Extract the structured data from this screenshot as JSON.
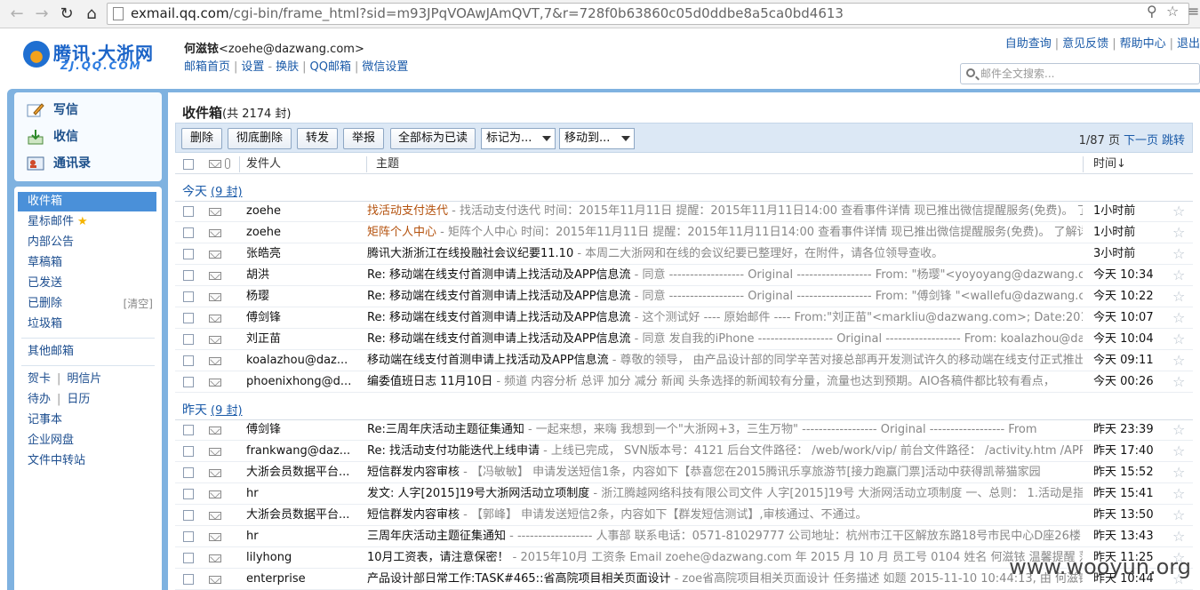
{
  "browser": {
    "url_host": "exmail.qq.com",
    "url_path": "/cgi-bin/frame_html?sid=m93JPqVOAwJAmQVT,7&r=728f0b63860c05d0ddbe8a5ca0bd4613"
  },
  "brand": {
    "name": "腾讯·大浙网",
    "sub": "ZJ.QQ.COM"
  },
  "user": {
    "name": "何滋铱",
    "email": "<zoehe@dazwang.com>"
  },
  "user_links": [
    "邮箱首页",
    "设置",
    "换肤",
    "QQ邮箱",
    "微信设置"
  ],
  "top_links": [
    "自助查询",
    "意见反馈",
    "帮助中心",
    "退出"
  ],
  "search": {
    "placeholder": "邮件全文搜索..."
  },
  "quick": {
    "compose": "写信",
    "receive": "收信",
    "contacts": "通讯录"
  },
  "nav": {
    "inbox": "收件箱",
    "starred": "星标邮件",
    "notice": "内部公告",
    "drafts": "草稿箱",
    "sent": "已发送",
    "deleted": "已删除",
    "deleted_extra": "[清空]",
    "spam": "垃圾箱",
    "other": "其他邮箱",
    "greeting": "贺卡",
    "postcard": "明信片",
    "todo": "待办",
    "calendar": "日历",
    "notes": "记事本",
    "disk": "企业网盘",
    "transfer": "文件中转站"
  },
  "mailbox": {
    "title": "收件箱",
    "count": "(共 2174 封)"
  },
  "toolbar": {
    "delete": "删除",
    "purge": "彻底删除",
    "forward": "转发",
    "report": "举报",
    "mark_all_read": "全部标为已读",
    "mark_as": "标记为...",
    "move_to": "移动到..."
  },
  "pager": {
    "page": "1/87 页",
    "next": "下一页",
    "jump": "跳转"
  },
  "columns": {
    "sender": "发件人",
    "subject": "主题",
    "time": "时间↓"
  },
  "groups": {
    "today": "今天",
    "today_count": "(9 封)",
    "yesterday": "昨天",
    "yesterday_count": "(9 封)"
  },
  "today_rows": [
    {
      "sender": "zoehe",
      "subject": "找活动支付迭代",
      "preview": " - 找活动支付迭代 时间：2015年11月11日 提醒：2015年11月11日14:00 查看事件详情 现已推出微信提醒服务(免费)。 了解详情",
      "time": "1小时前"
    },
    {
      "sender": "zoehe",
      "subject": "矩阵个人中心",
      "preview": " - 矩阵个人中心 时间：2015年11月11日 提醒：2015年11月11日14:00 查看事件详情 现已推出微信提醒服务(免费)。 了解详情 您的",
      "time": "1小时前"
    },
    {
      "sender": "张皓亮",
      "subject": "腾讯大浙浙江在线投融社会议纪要11.10",
      "preview": " - 本周二大浙网和在线的会议纪要已整理好，在附件，请各位领导查收。",
      "time": "3小时前"
    },
    {
      "sender": "胡洪",
      "subject": "Re: 移动端在线支付首测申请上找活动及APP信息流",
      "preview": " - 同意 ------------------ Original ------------------ From: \"杨璎\"<yoyoyang@dazwang.com>",
      "time": "今天 10:34"
    },
    {
      "sender": "杨璎",
      "subject": "Re: 移动端在线支付首测申请上找活动及APP信息流",
      "preview": " - 同意 ------------------ Original ------------------ From: \"傅剑锋 \"<wallefu@dazwang.com>",
      "time": "今天 10:22"
    },
    {
      "sender": "傅剑锋",
      "subject": "Re: 移动端在线支付首测申请上找活动及APP信息流",
      "preview": " - 这个测试好 ---- 原始邮件 ---- From:\"刘正苗\"<markliu@dazwang.com>; Date:2015年11月",
      "time": "今天 10:07"
    },
    {
      "sender": "刘正苗",
      "subject": "Re: 移动端在线支付首测申请上找活动及APP信息流",
      "preview": " - 同意 发自我的iPhone ------------------ Original ------------------ From: koalazhou@dazwang",
      "time": "今天 10:04"
    },
    {
      "sender": "koalazhou@daz...",
      "subject": "移动端在线支付首测申请上找活动及APP信息流",
      "preview": " - 尊敬的领导， 由产品设计部的同学辛苦对接总部再开发测试许久的移动端在线支付正式推出，总部支付",
      "time": "今天 09:11"
    },
    {
      "sender": "phoenixhong@d...",
      "subject": "编委值班日志 11月10日",
      "preview": " - 频道 内容分析 总评 加分 减分 新闻 头条选择的新闻较有分量，流量也达到预期。AIO各稿件都比较有看点，",
      "time": "今天 00:26"
    }
  ],
  "yesterday_rows": [
    {
      "sender": "傅剑锋",
      "subject": "Re:三周年庆活动主题征集通知",
      "preview": " - 一起来想，来嗨 我想到一个\"大浙网+3，三生万物\" ------------------ Original ------------------ From",
      "time": "昨天 23:39"
    },
    {
      "sender": "frankwang@daz...",
      "subject": "Re: 找活动支付功能迭代上线申请",
      "preview": " - 上线已完成， SVN版本号：4121 后台文件路径： /web/work/vip/ 前台文件路径： /activity.htm /APP/android",
      "time": "昨天 17:40"
    },
    {
      "sender": "大浙会员数据平台...",
      "subject": "短信群发内容审核",
      "preview": " - 【冯敏敏】 申请发送短信1条，内容如下【恭喜您在2015腾讯乐享旅游节[接力跑赢门票]活动中获得凯蒂猫家园",
      "time": "昨天 15:52"
    },
    {
      "sender": "hr",
      "subject": "发文: 人字[2015]19号大浙网活动立项制度",
      "preview": " - 浙江腾越网络科技有限公司文件 人字[2015]19号 大浙网活动立项制度 一、总则： 1.活动是指由大浙网",
      "time": "昨天 15:41"
    },
    {
      "sender": "大浙会员数据平台...",
      "subject": "短信群发内容审核",
      "preview": " - 【郭峰】 申请发送短信2条，内容如下【群发短信测试】,审核通过、不通过。",
      "time": "昨天 13:50"
    },
    {
      "sender": "hr",
      "subject": "三周年庆活动主题征集通知",
      "preview": " - ------------------ 人事部 联系电话：0571-81029777 公司地址：杭州市江干区解放东路18号市民中心D座26楼",
      "time": "昨天 13:43"
    },
    {
      "sender": "lilyhong",
      "subject": "10月工资表，请注意保密！",
      "preview": " - 2015年10月 工资条 Email zoehe@dazwang.com 年 2015 月 10 月 员工号 0104 姓名 何滋铱 温馨提醒 落名门户",
      "time": "昨天 11:25"
    },
    {
      "sender": "enterprise",
      "subject": "产品设计部日常工作:TASK#465::省高院项目相关页面设计",
      "preview": " - zoe省高院项目相关页面设计 任务描述 如题 2015-11-10 10:44:13, 由 何滋铱 指派给 何滋铱",
      "time": "昨天 10:44"
    }
  ],
  "watermark": "www.wooyun.org"
}
